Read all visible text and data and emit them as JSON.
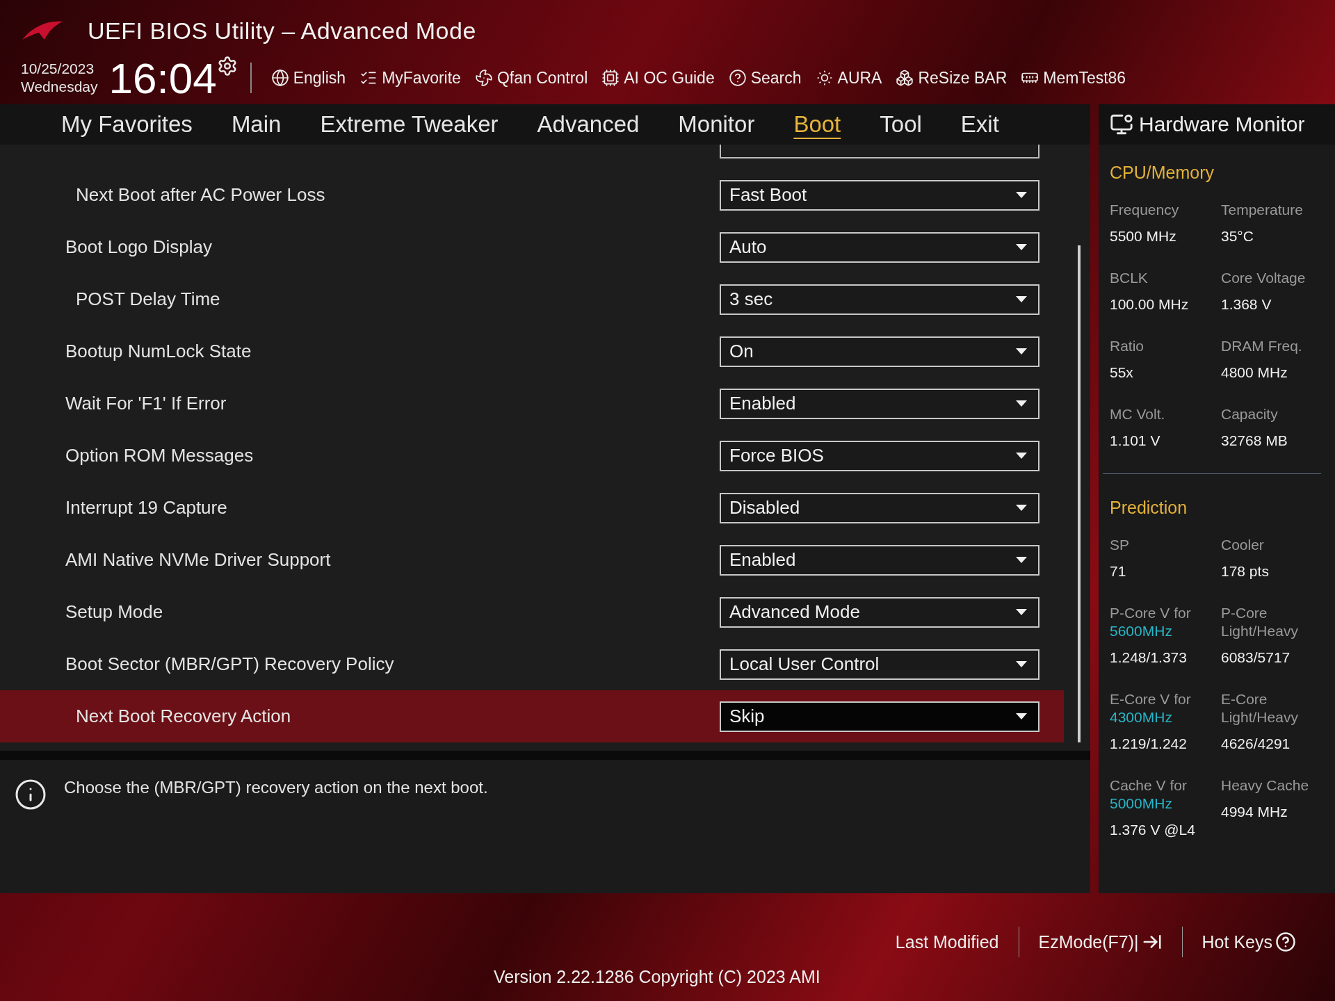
{
  "header": {
    "title": "UEFI BIOS Utility – Advanced Mode",
    "date": "10/25/2023",
    "weekday": "Wednesday",
    "time": "16:04",
    "tools": [
      {
        "kind": "globe",
        "label": "English"
      },
      {
        "kind": "favorite",
        "label": "MyFavorite"
      },
      {
        "kind": "fan",
        "label": "Qfan Control"
      },
      {
        "kind": "chip",
        "label": "AI OC Guide"
      },
      {
        "kind": "help",
        "label": "Search"
      },
      {
        "kind": "light",
        "label": "AURA"
      },
      {
        "kind": "bar",
        "label": "ReSize BAR"
      },
      {
        "kind": "memory",
        "label": "MemTest86"
      }
    ]
  },
  "tabs": [
    {
      "label": "My Favorites",
      "selected": false
    },
    {
      "label": "Main",
      "selected": false
    },
    {
      "label": "Extreme Tweaker",
      "selected": false
    },
    {
      "label": "Advanced",
      "selected": false
    },
    {
      "label": "Monitor",
      "selected": false
    },
    {
      "label": "Boot",
      "selected": true
    },
    {
      "label": "Tool",
      "selected": false
    },
    {
      "label": "Exit",
      "selected": false
    }
  ],
  "settings": [
    {
      "kind": "sub",
      "label": "Next Boot after AC Power Loss",
      "value": "Fast Boot",
      "selected": false
    },
    {
      "kind": "main",
      "label": "Boot Logo Display",
      "value": "Auto",
      "selected": false
    },
    {
      "kind": "sub",
      "label": "POST Delay Time",
      "value": "3 sec",
      "selected": false
    },
    {
      "kind": "main",
      "label": "Bootup NumLock State",
      "value": "On",
      "selected": false
    },
    {
      "kind": "main",
      "label": "Wait For 'F1' If Error",
      "value": "Enabled",
      "selected": false
    },
    {
      "kind": "main",
      "label": "Option ROM Messages",
      "value": "Force BIOS",
      "selected": false
    },
    {
      "kind": "main",
      "label": "Interrupt 19 Capture",
      "value": "Disabled",
      "selected": false
    },
    {
      "kind": "main",
      "label": "AMI Native NVMe Driver Support",
      "value": "Enabled",
      "selected": false
    },
    {
      "kind": "main",
      "label": "Setup Mode",
      "value": "Advanced Mode",
      "selected": false
    },
    {
      "kind": "main",
      "label": "Boot Sector (MBR/GPT) Recovery Policy",
      "value": "Local User Control",
      "selected": false
    },
    {
      "kind": "sub",
      "label": "Next Boot Recovery Action",
      "value": "Skip",
      "selected": true
    }
  ],
  "help_text": "Choose the (MBR/GPT) recovery action on the next boot.",
  "hardware_monitor": {
    "title": "Hardware Monitor",
    "sections": [
      {
        "title": "CPU/Memory",
        "items": [
          {
            "label": "Frequency",
            "value": "5500 MHz"
          },
          {
            "label": "Temperature",
            "value": "35°C"
          },
          {
            "label": "BCLK",
            "value": "100.00 MHz"
          },
          {
            "label": "Core Voltage",
            "value": "1.368 V"
          },
          {
            "label": "Ratio",
            "value": "55x"
          },
          {
            "label": "DRAM Freq.",
            "value": "4800 MHz"
          },
          {
            "label": "MC Volt.",
            "value": "1.101 V"
          },
          {
            "label": "Capacity",
            "value": "32768 MB"
          }
        ]
      },
      {
        "title": "Prediction",
        "items": [
          {
            "label": "SP",
            "value": "71"
          },
          {
            "label": "Cooler",
            "value": "178 pts"
          },
          {
            "label": "P-Core V for",
            "freq": "5600MHz",
            "value": "1.248/1.373"
          },
          {
            "label": "P-Core Light/Heavy",
            "value": "6083/5717"
          },
          {
            "label": "E-Core V for",
            "freq": "4300MHz",
            "value": "1.219/1.242"
          },
          {
            "label": "E-Core Light/Heavy",
            "value": "4626/4291"
          },
          {
            "label": "Cache V for",
            "freq": "5000MHz",
            "value": "1.376 V @L4"
          },
          {
            "label": "Heavy Cache",
            "value": "4994 MHz"
          }
        ]
      }
    ]
  },
  "footer": {
    "actions": [
      {
        "kind": "plain",
        "label": "Last Modified"
      },
      {
        "kind": "ezmode",
        "label": "EzMode(F7)|"
      },
      {
        "kind": "hotkeys",
        "label": "Hot Keys"
      }
    ],
    "version": "Version 2.22.1286 Copyright (C) 2023 AMI"
  }
}
